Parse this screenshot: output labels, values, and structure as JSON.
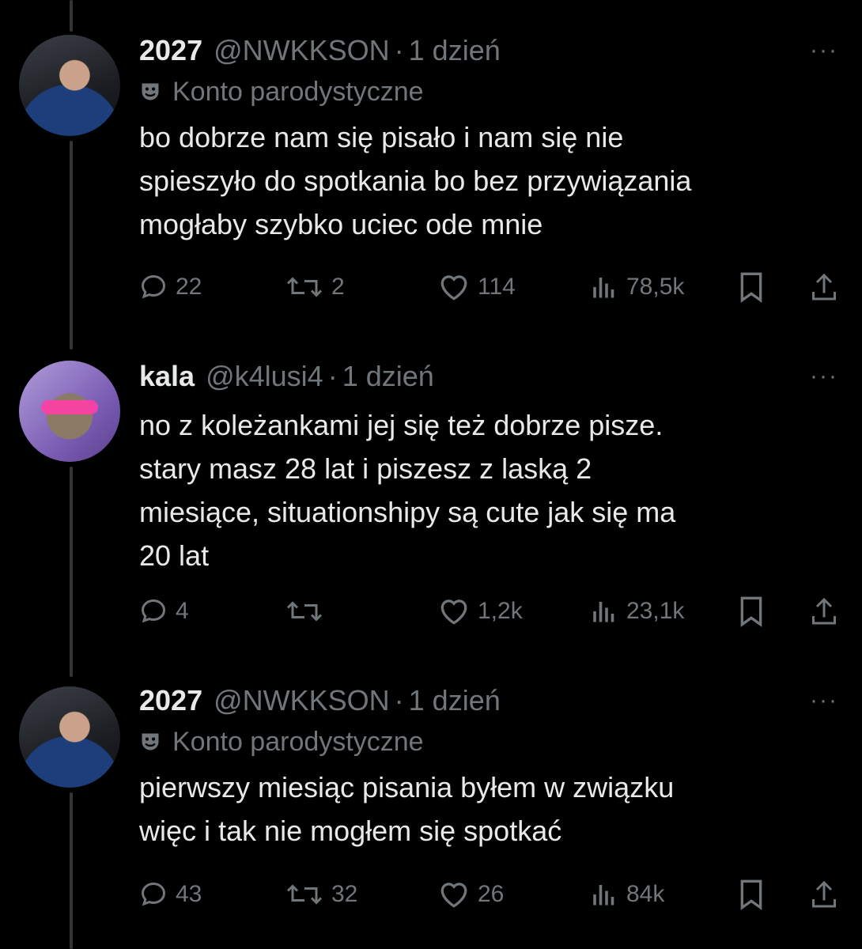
{
  "tweets": [
    {
      "name": "2027",
      "handle": "@NWKKSON",
      "time": "1 dzień",
      "label": "Konto parodystyczne",
      "lines": [
        "bo dobrze nam się pisało i nam się nie",
        "spieszyło do spotkania bo bez przywiązania",
        "mogłaby szybko uciec ode mnie"
      ],
      "actions": {
        "replies": "22",
        "retweets": "2",
        "likes": "114",
        "views": "78,5k"
      }
    },
    {
      "name": "kala",
      "handle": "@k4lusi4",
      "time": "1 dzień",
      "label": "",
      "lines": [
        "no z koleżankami jej się też dobrze pisze.",
        "stary masz 28 lat i piszesz z laską 2",
        "miesiące, situationshipy są cute jak się ma",
        "20 lat"
      ],
      "actions": {
        "replies": "4",
        "retweets": "",
        "likes": "1,2k",
        "views": "23,1k"
      }
    },
    {
      "name": "2027",
      "handle": "@NWKKSON",
      "time": "1 dzień",
      "label": "Konto parodystyczne",
      "lines": [
        "pierwszy miesiąc pisania byłem w związku",
        "więc i tak nie mogłem się spotkać"
      ],
      "actions": {
        "replies": "43",
        "retweets": "32",
        "likes": "26",
        "views": "84k"
      }
    }
  ],
  "ui": {
    "more": "···",
    "dot": "·"
  }
}
